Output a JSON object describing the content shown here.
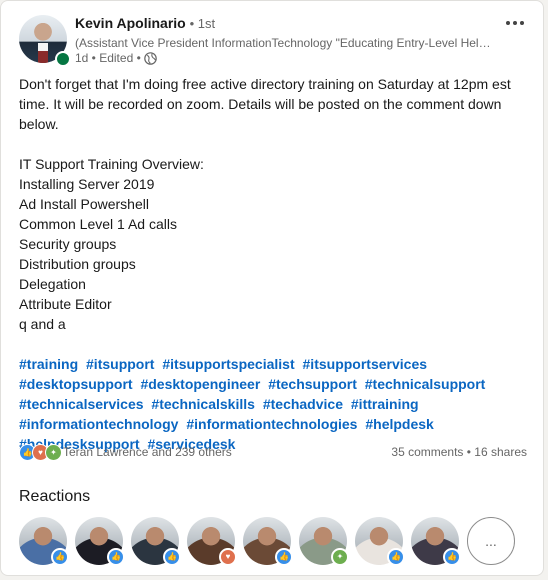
{
  "author": {
    "name": "Kevin Apolinario",
    "degree": "• 1st",
    "headline": "(Assistant Vice President InformationTechnology \"Educating Entry-Level Help...",
    "meta": "1d • Edited •"
  },
  "post": {
    "intro": "Don't forget that I'm doing free active directory training on Saturday at 12pm est time. It will be recorded on zoom. Details will be posted on the comment down below.",
    "overview_title": "IT Support Training Overview:",
    "items": [
      "Installing Server 2019",
      "Ad Install Powershell",
      "Common Level 1 Ad calls",
      "Security groups",
      "Distribution groups",
      "Delegation",
      "Attribute Editor",
      "q and a"
    ],
    "hashtags": [
      "#training",
      "#itsupport",
      "#itsupportspecialist",
      "#itsupportservices",
      "#desktopsupport",
      "#desktopengineer",
      "#techsupport",
      "#technicalsupport",
      "#technicalservices",
      "#technicalskills",
      "#techadvice",
      "#ittraining",
      "#informationtechnology",
      "#informationtechnologies",
      "#helpdesk",
      "#helpdesksupport",
      "#servicedesk"
    ]
  },
  "social": {
    "reaction_summary": "Teran Lawrence and 239 others",
    "counts": "35 comments • 16 shares"
  },
  "reactions": {
    "title": "Reactions",
    "more_label": "...",
    "reactors": [
      {
        "badge": "like-icon",
        "badge_color": "#378fe9",
        "tone": "#4a6fa5"
      },
      {
        "badge": "like-icon",
        "badge_color": "#378fe9",
        "tone": "#1c1c24"
      },
      {
        "badge": "like-icon",
        "badge_color": "#378fe9",
        "tone": "#2b3540"
      },
      {
        "badge": "love-icon",
        "badge_color": "#df704d",
        "tone": "#5a3b2a"
      },
      {
        "badge": "like-icon",
        "badge_color": "#378fe9",
        "tone": "#6b4a36"
      },
      {
        "badge": "insightful-icon",
        "badge_color": "#6dae4f",
        "tone": "#8a9a88"
      },
      {
        "badge": "like-icon",
        "badge_color": "#378fe9",
        "tone": "#e9e4df"
      },
      {
        "badge": "like-icon",
        "badge_color": "#378fe9",
        "tone": "#3e3a48"
      }
    ]
  },
  "colors": {
    "link": "#0a66c2",
    "online": "#057642",
    "like": "#378fe9",
    "love": "#df704d",
    "insightful": "#6dae4f",
    "celebrate": "#6dae4f"
  }
}
